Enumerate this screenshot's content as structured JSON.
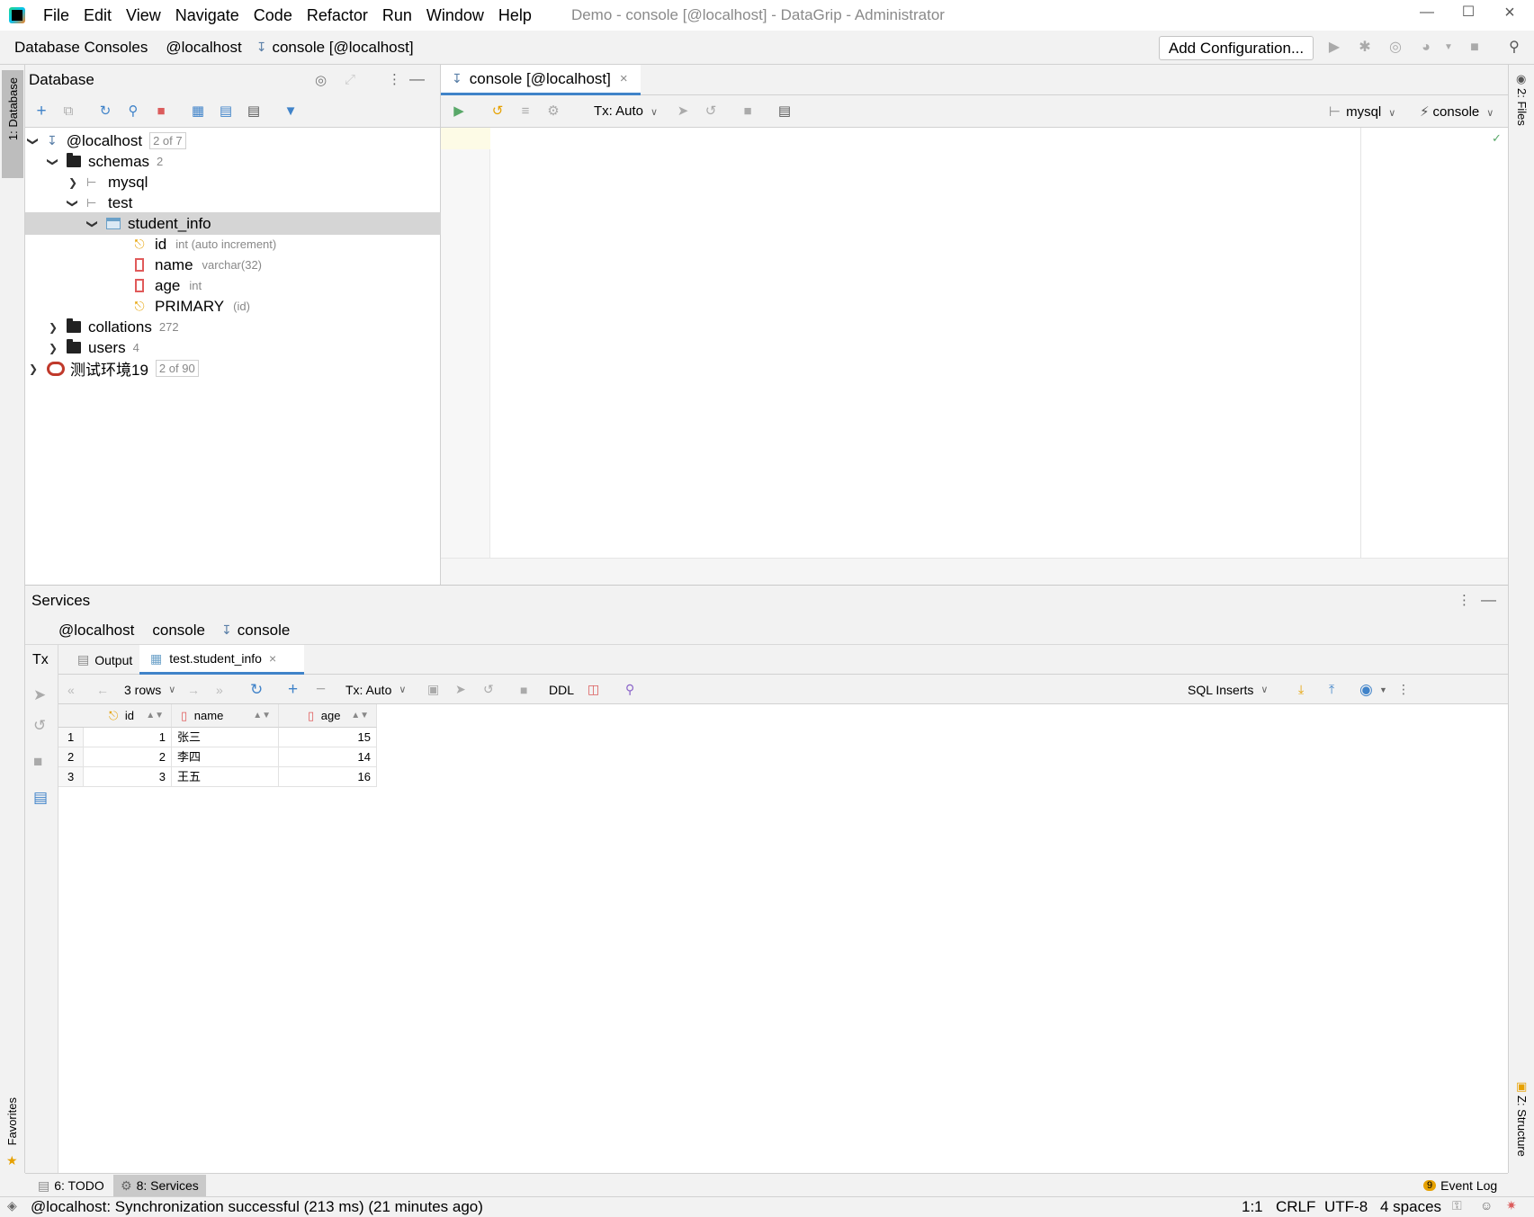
{
  "titlebar": {
    "menu": [
      "File",
      "Edit",
      "View",
      "Navigate",
      "Code",
      "Refactor",
      "Run",
      "Window",
      "Help"
    ],
    "window_title": "Demo - console [@localhost] - DataGrip - Administrator"
  },
  "navbar": {
    "crumbs": [
      "Database Consoles",
      "@localhost",
      "console [@localhost]"
    ],
    "add_configuration": "Add Configuration..."
  },
  "left_stripe": {
    "database_tab": "1: Database",
    "favorites_tab": "Favorites"
  },
  "right_stripe": {
    "files_tab": "2: Files",
    "structure_tab": "Z: Structure"
  },
  "database_panel": {
    "title": "Database",
    "tree": {
      "datasource": {
        "name": "@localhost",
        "badge": "2 of 7"
      },
      "schemas": {
        "name": "schemas",
        "count": "2"
      },
      "schema_mysql": "mysql",
      "schema_test": "test",
      "table": "student_info",
      "columns": [
        {
          "name": "id",
          "type": "int (auto increment)"
        },
        {
          "name": "name",
          "type": "varchar(32)"
        },
        {
          "name": "age",
          "type": "int"
        }
      ],
      "primary_key": {
        "name": "PRIMARY",
        "cols": "(id)"
      },
      "collations": {
        "name": "collations",
        "count": "272"
      },
      "users": {
        "name": "users",
        "count": "4"
      },
      "datasource2": {
        "name": "测试环境19",
        "badge": "2 of 90"
      }
    }
  },
  "editor": {
    "tab_label": "console [@localhost]",
    "tx_mode": "Tx: Auto",
    "schema_selector": "mysql",
    "session_selector": "console"
  },
  "services": {
    "title": "Services",
    "crumbs": [
      "@localhost",
      "console",
      "console"
    ],
    "left_tx": "Tx",
    "tabs": {
      "output": "Output",
      "result": "test.student_info"
    },
    "toolbar": {
      "rows": "3 rows",
      "tx_mode": "Tx: Auto",
      "ddl": "DDL",
      "extractor": "SQL Inserts"
    },
    "grid": {
      "columns": [
        "id",
        "name",
        "age"
      ],
      "rows": [
        {
          "num": "1",
          "id": "1",
          "name": "张三",
          "age": "15"
        },
        {
          "num": "2",
          "id": "2",
          "name": "李四",
          "age": "14"
        },
        {
          "num": "3",
          "id": "3",
          "name": "王五",
          "age": "16"
        }
      ]
    }
  },
  "bottom_tabs": {
    "todo": "6: TODO",
    "services": "8: Services",
    "event_log": "Event Log",
    "event_count": "9"
  },
  "statusbar": {
    "message": "@localhost: Synchronization successful (213 ms) (21 minutes ago)",
    "position": "1:1",
    "line_sep": "CRLF",
    "encoding": "UTF-8",
    "indent": "4 spaces"
  },
  "colors": {
    "accent": "#4083c9",
    "run_green": "#59a869",
    "stop_red": "#db5c5c",
    "key_yellow": "#e6a100",
    "selection": "#d5d5d5"
  }
}
